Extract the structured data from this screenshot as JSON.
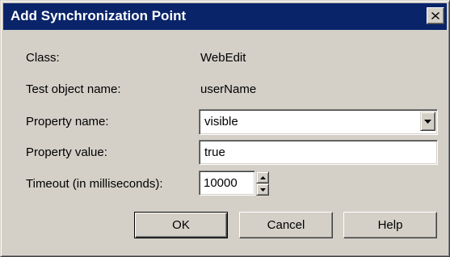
{
  "dialog": {
    "title": "Add Synchronization Point",
    "close_glyph": "✕"
  },
  "fields": {
    "class_label": "Class:",
    "class_value": "WebEdit",
    "test_object_label": "Test object name:",
    "test_object_value": "userName",
    "property_name_label": "Property name:",
    "property_name_value": "visible",
    "property_value_label": "Property value:",
    "property_value_value": "true",
    "timeout_label": "Timeout (in milliseconds):",
    "timeout_value": "10000"
  },
  "buttons": {
    "ok_label": "OK",
    "cancel_label": "Cancel",
    "help_label": "Help"
  },
  "icons": {
    "close": "close-icon",
    "dropdown": "chevron-down-icon",
    "spin_up": "spin-up-icon",
    "spin_down": "spin-down-icon"
  },
  "colors": {
    "titlebar": "#0a246a",
    "dialog_face": "#d4d0c8"
  }
}
